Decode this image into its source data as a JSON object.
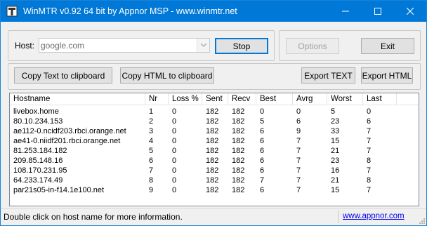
{
  "window": {
    "title": "WinMTR v0.92 64 bit by Appnor MSP - www.winmtr.net",
    "accent": "#0078d7"
  },
  "host": {
    "label": "Host:",
    "value": "google.com"
  },
  "buttons": {
    "stop": "Stop",
    "options": "Options",
    "exit": "Exit",
    "copy_text": "Copy Text to clipboard",
    "copy_html": "Copy HTML to clipboard",
    "export_text": "Export TEXT",
    "export_html": "Export HTML"
  },
  "table": {
    "columns": [
      "Hostname",
      "Nr",
      "Loss %",
      "Sent",
      "Recv",
      "Best",
      "Avrg",
      "Worst",
      "Last"
    ],
    "rows": [
      [
        "livebox.home",
        "1",
        "0",
        "182",
        "182",
        "0",
        "0",
        "5",
        "0"
      ],
      [
        "80.10.234.153",
        "2",
        "0",
        "182",
        "182",
        "5",
        "6",
        "23",
        "6"
      ],
      [
        "ae112-0.ncidf203.rbci.orange.net",
        "3",
        "0",
        "182",
        "182",
        "6",
        "9",
        "33",
        "7"
      ],
      [
        "ae41-0.niidf201.rbci.orange.net",
        "4",
        "0",
        "182",
        "182",
        "6",
        "7",
        "15",
        "7"
      ],
      [
        "81.253.184.182",
        "5",
        "0",
        "182",
        "182",
        "6",
        "7",
        "21",
        "7"
      ],
      [
        "209.85.148.16",
        "6",
        "0",
        "182",
        "182",
        "6",
        "7",
        "23",
        "8"
      ],
      [
        "108.170.231.95",
        "7",
        "0",
        "182",
        "182",
        "6",
        "7",
        "16",
        "7"
      ],
      [
        "64.233.174.49",
        "8",
        "0",
        "182",
        "182",
        "7",
        "7",
        "21",
        "8"
      ],
      [
        "par21s05-in-f14.1e100.net",
        "9",
        "0",
        "182",
        "182",
        "6",
        "7",
        "15",
        "7"
      ]
    ]
  },
  "status": {
    "message": "Double click on host name for more information.",
    "link": "www.appnor.com"
  }
}
